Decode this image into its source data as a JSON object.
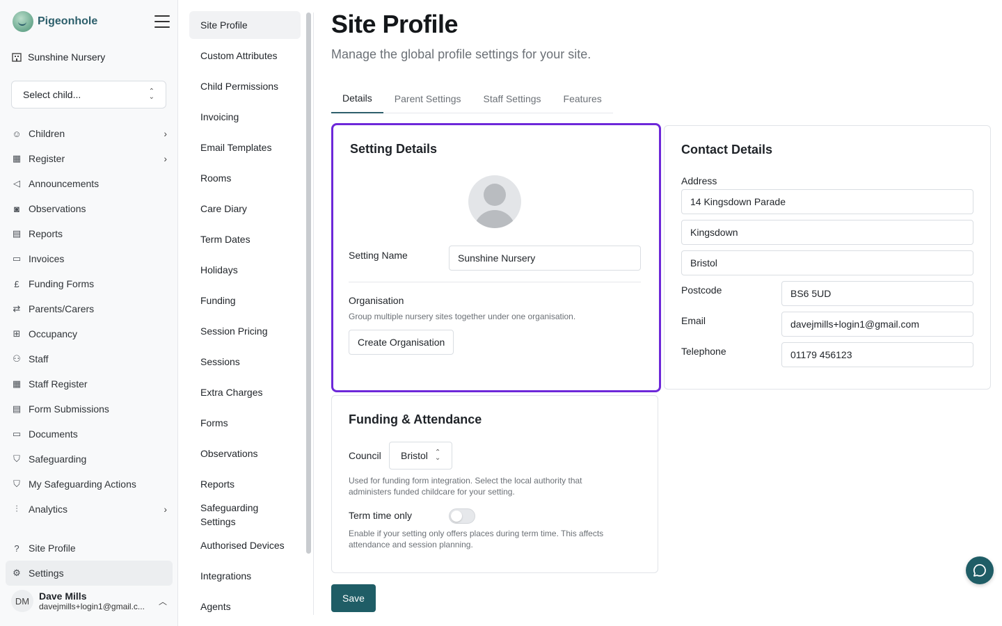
{
  "brand": {
    "name": "Pigeonhole"
  },
  "site": {
    "name": "Sunshine Nursery",
    "child_select_placeholder": "Select child..."
  },
  "sidebar": {
    "items": [
      {
        "label": "Children",
        "icon": "child-face-icon",
        "has_chevron": true
      },
      {
        "label": "Register",
        "icon": "calendar-check-icon",
        "has_chevron": true
      },
      {
        "label": "Announcements",
        "icon": "megaphone-icon"
      },
      {
        "label": "Observations",
        "icon": "camera-icon"
      },
      {
        "label": "Reports",
        "icon": "document-icon"
      },
      {
        "label": "Invoices",
        "icon": "wallet-icon"
      },
      {
        "label": "Funding Forms",
        "icon": "pound-icon"
      },
      {
        "label": "Parents/Carers",
        "icon": "link-users-icon"
      },
      {
        "label": "Occupancy",
        "icon": "grid-icon"
      },
      {
        "label": "Staff",
        "icon": "users-icon"
      },
      {
        "label": "Staff Register",
        "icon": "calendar-icon"
      },
      {
        "label": "Form Submissions",
        "icon": "document-icon"
      },
      {
        "label": "Documents",
        "icon": "folder-icon"
      },
      {
        "label": "Safeguarding",
        "icon": "shield-icon"
      },
      {
        "label": "My Safeguarding Actions",
        "icon": "shield-icon"
      },
      {
        "label": "Analytics",
        "icon": "bar-chart-icon",
        "has_chevron": true
      }
    ],
    "bottom_items": [
      {
        "label": "Site Profile",
        "icon": "question-circle-icon"
      },
      {
        "label": "Settings",
        "icon": "gear-icon",
        "active": true
      }
    ],
    "user": {
      "initials": "DM",
      "name": "Dave Mills",
      "email": "davejmills+login1@gmail.c..."
    }
  },
  "settings_nav": {
    "items": [
      "Site Profile",
      "Custom Attributes",
      "Child Permissions",
      "Invoicing",
      "Email Templates",
      "Rooms",
      "Care Diary",
      "Term Dates",
      "Holidays",
      "Funding",
      "Session Pricing",
      "Sessions",
      "Extra Charges",
      "Forms",
      "Observations",
      "Reports",
      "Safeguarding Settings",
      "Authorised Devices",
      "Integrations",
      "Agents"
    ],
    "active": "Site Profile"
  },
  "page": {
    "title": "Site Profile",
    "subtitle": "Manage the global profile settings for your site.",
    "tabs": [
      "Details",
      "Parent Settings",
      "Staff Settings",
      "Features"
    ],
    "active_tab": "Details"
  },
  "setting_details": {
    "title": "Setting Details",
    "setting_name_label": "Setting Name",
    "setting_name_value": "Sunshine Nursery",
    "organisation_label": "Organisation",
    "organisation_hint": "Group multiple nursery sites together under one organisation.",
    "create_org_label": "Create Organisation"
  },
  "contact_details": {
    "title": "Contact Details",
    "address_label": "Address",
    "address_line1": "14 Kingsdown Parade",
    "address_line2": "Kingsdown",
    "address_line3": "Bristol",
    "postcode_label": "Postcode",
    "postcode_value": "BS6 5UD",
    "email_label": "Email",
    "email_value": "davejmills+login1@gmail.com",
    "telephone_label": "Telephone",
    "telephone_value": "01179 456123"
  },
  "funding_attendance": {
    "title": "Funding & Attendance",
    "council_label": "Council",
    "council_value": "Bristol",
    "council_hint_1": "Used for funding form integration. Select the local authority that",
    "council_hint_2": "administers funded childcare for your setting.",
    "term_time_label": "Term time only",
    "term_time_on": false,
    "term_time_hint_1": "Enable if your setting only offers places during term time. This affects",
    "term_time_hint_2": "attendance and session planning."
  },
  "actions": {
    "save_label": "Save"
  },
  "colors": {
    "brand": "#2d5f6b",
    "primary_button": "#1f5d66",
    "highlight_border": "#6d28d9"
  }
}
